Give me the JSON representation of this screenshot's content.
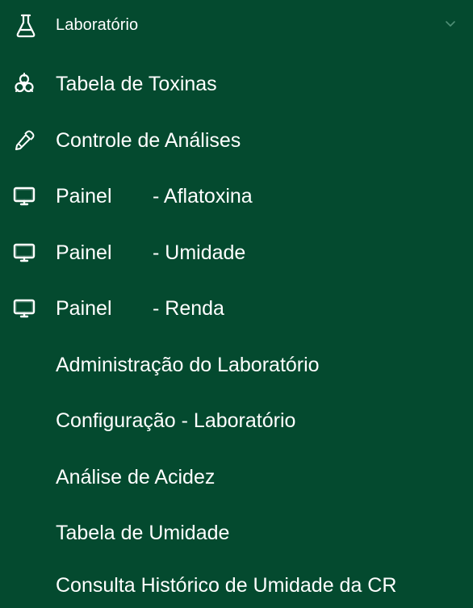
{
  "menu": {
    "header": {
      "label": "Laboratório",
      "icon": "flask-icon",
      "toggle_icon": "chevron-down-icon"
    },
    "items": [
      {
        "label": "Tabela de Toxinas",
        "icon": "biohazard-icon"
      },
      {
        "label": "Controle de Análises",
        "icon": "pipette-icon"
      },
      {
        "label": "Painel",
        "suffix": "- Aflatoxina",
        "icon": "monitor-icon"
      },
      {
        "label": "Painel",
        "suffix": "- Umidade",
        "icon": "monitor-icon"
      },
      {
        "label": "Painel",
        "suffix": "- Renda",
        "icon": "monitor-icon"
      },
      {
        "label": "Administração do Laboratório"
      },
      {
        "label": "Configuração - Laboratório"
      },
      {
        "label": "Análise de Acidez"
      },
      {
        "label": "Tabela de Umidade"
      },
      {
        "label": "Consulta Histórico de Umidade da CR"
      }
    ],
    "colors": {
      "background": "#044a2f",
      "text": "#ffffff",
      "chevron": "#4f8f76"
    }
  }
}
